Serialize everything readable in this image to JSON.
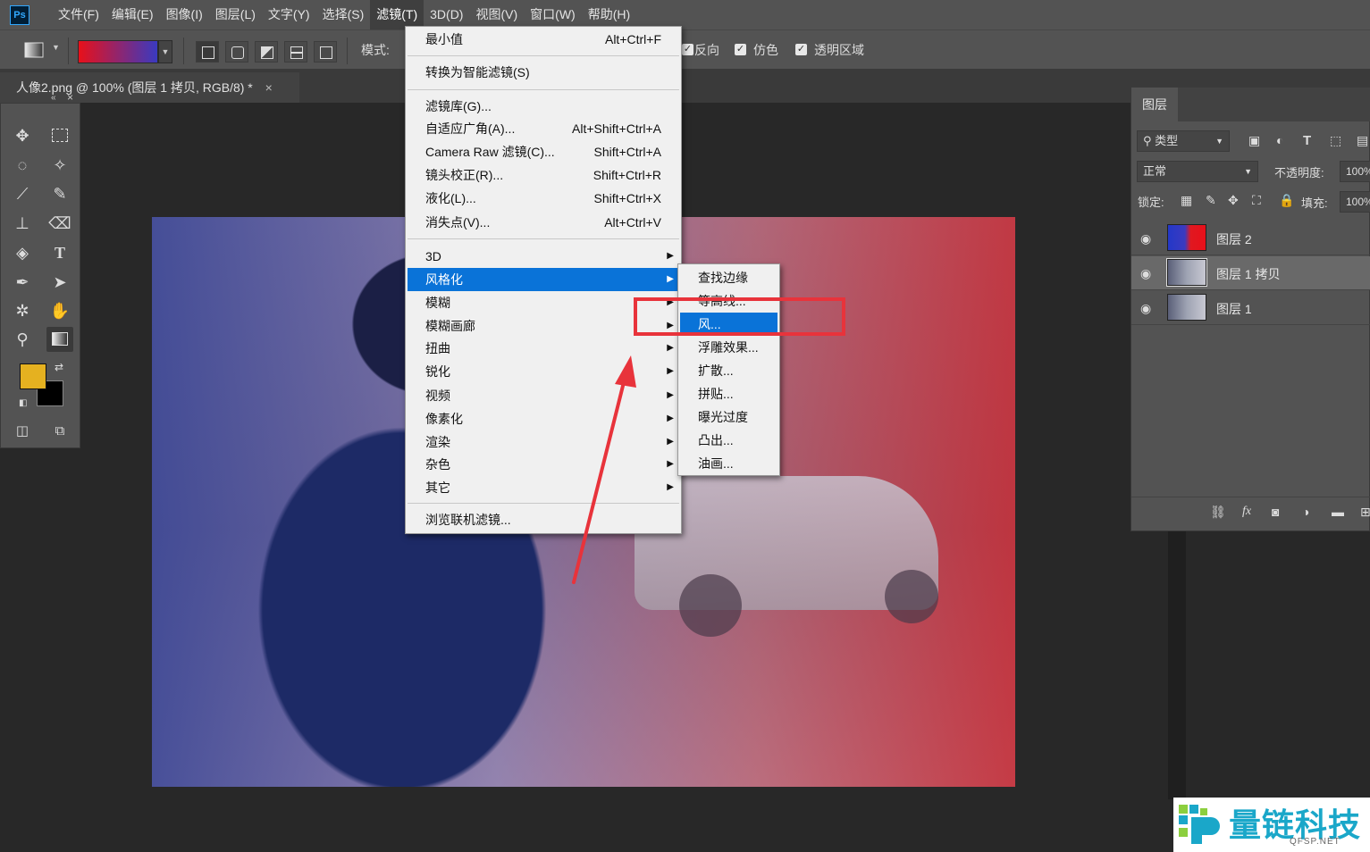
{
  "app": {
    "logo": "Ps"
  },
  "menubar": {
    "items": [
      "文件(F)",
      "编辑(E)",
      "图像(I)",
      "图层(L)",
      "文字(Y)",
      "选择(S)",
      "滤镜(T)",
      "3D(D)",
      "视图(V)",
      "窗口(W)",
      "帮助(H)"
    ],
    "active_index": 6
  },
  "options_bar": {
    "mode_label": "模式:",
    "reverse_label": "反向",
    "dither_label": "仿色",
    "transparency_label": "透明区域",
    "gradient_colors": [
      "#e8101a",
      "#3a3ac0"
    ]
  },
  "document_tab": {
    "title": "人像2.png @ 100% (图层 1 拷贝, RGB/8) *",
    "close": "×"
  },
  "toolbox": {
    "foreground_color": "#e5b120",
    "background_color": "#000000"
  },
  "filter_menu": {
    "last_filter": {
      "label": "最小值",
      "shortcut": "Alt+Ctrl+F"
    },
    "convert_smart": "转换为智能滤镜(S)",
    "gallery": [
      {
        "label": "滤镜库(G)...",
        "shortcut": ""
      },
      {
        "label": "自适应广角(A)...",
        "shortcut": "Alt+Shift+Ctrl+A"
      },
      {
        "label": "Camera Raw 滤镜(C)...",
        "shortcut": "Shift+Ctrl+A"
      },
      {
        "label": "镜头校正(R)...",
        "shortcut": "Shift+Ctrl+R"
      },
      {
        "label": "液化(L)...",
        "shortcut": "Shift+Ctrl+X"
      },
      {
        "label": "消失点(V)...",
        "shortcut": "Alt+Ctrl+V"
      }
    ],
    "categories": [
      "3D",
      "风格化",
      "模糊",
      "模糊画廊",
      "扭曲",
      "锐化",
      "视频",
      "像素化",
      "渲染",
      "杂色",
      "其它"
    ],
    "highlighted_category": "风格化",
    "browse_online": "浏览联机滤镜..."
  },
  "stylize_submenu": {
    "items": [
      "查找边缘",
      "等高线...",
      "风...",
      "浮雕效果...",
      "扩散...",
      "拼贴...",
      "曝光过度",
      "凸出...",
      "油画..."
    ],
    "highlighted": "风..."
  },
  "layers_panel": {
    "tab": "图层",
    "filter_kind": "类型",
    "blend_mode": "正常",
    "opacity_label": "不透明度:",
    "opacity_value": "100%",
    "lock_label": "锁定:",
    "fill_label": "填充:",
    "fill_value": "100%",
    "layers": [
      {
        "name": "图层 2",
        "selected": false
      },
      {
        "name": "图层 1 拷贝",
        "selected": true
      },
      {
        "name": "图层 1",
        "selected": false
      }
    ],
    "bottom_fx": "fx"
  },
  "watermark": {
    "text": "量链科技",
    "sub": "QFSP.NET",
    "color": "#1aa7c9"
  },
  "annotation_color": "#e8333b"
}
